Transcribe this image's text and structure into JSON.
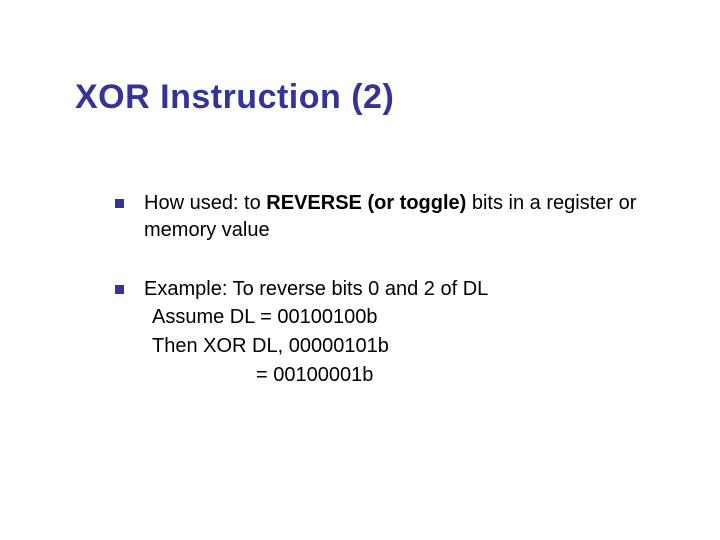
{
  "title": "XOR Instruction (2)",
  "bullet1": {
    "prefix": "How used:  to ",
    "bold": "REVERSE (or toggle)",
    "suffix": " bits in a register or memory value"
  },
  "bullet2": {
    "intro": "Example: To reverse bits 0 and 2 of DL",
    "line1": "Assume   DL = 00100100b",
    "line2": "Then  XOR DL, 00000101b",
    "line3": "= 00100001b"
  }
}
